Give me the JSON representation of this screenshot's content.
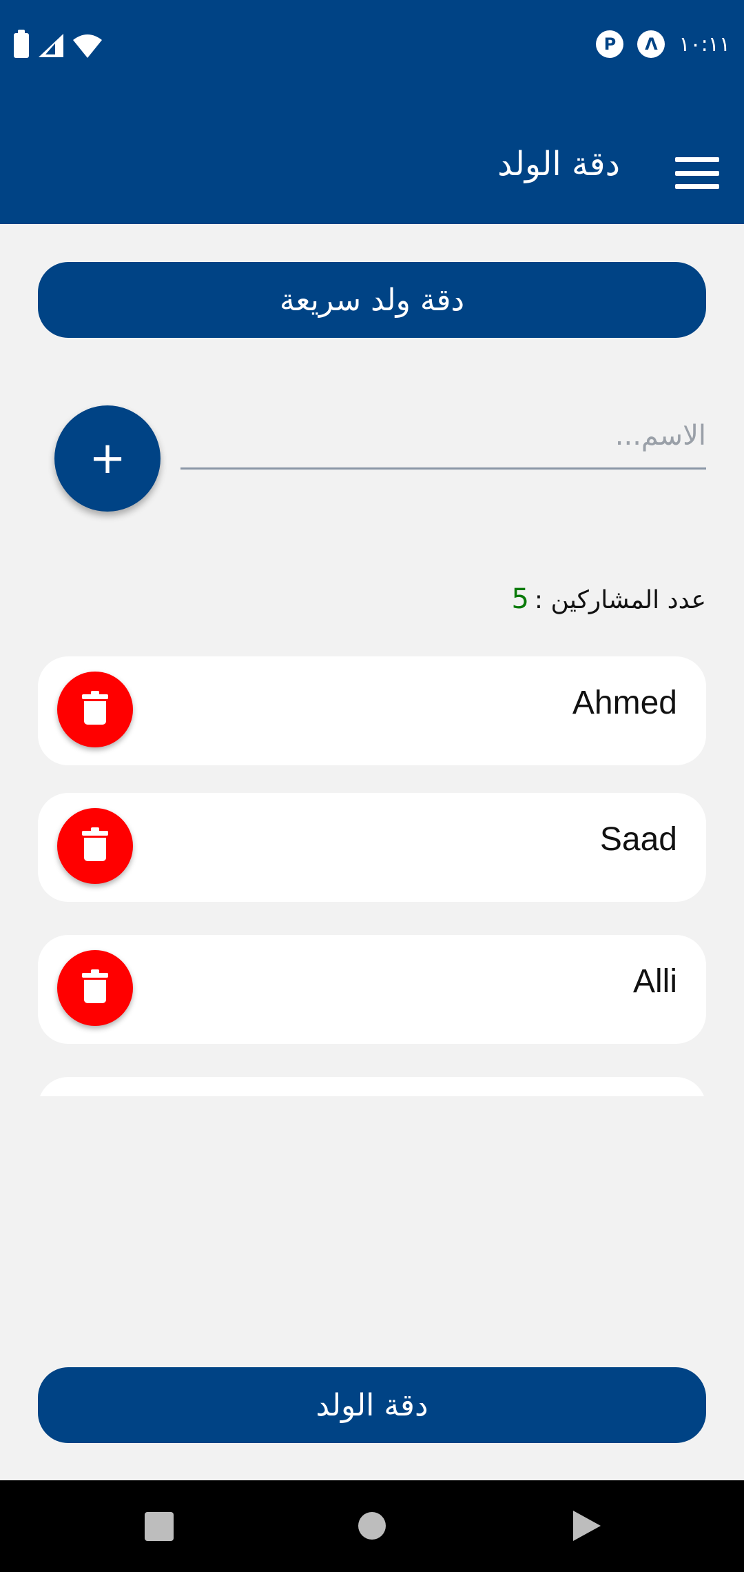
{
  "status_bar": {
    "time": "١٠:١١",
    "icons": [
      "battery-icon",
      "signal-icon",
      "wifi-icon",
      "app-notification-icon",
      "vpn-icon"
    ]
  },
  "app_bar": {
    "title": "دقة الولد",
    "menu_icon": "hamburger-menu-icon"
  },
  "quick_button": {
    "label": "دقة ولد سريعة"
  },
  "name_input": {
    "placeholder": "الاسم...",
    "value": ""
  },
  "add_button": {
    "label": "+"
  },
  "participants": {
    "label": "عدد المشاركين :",
    "count": "5"
  },
  "list": {
    "items": [
      {
        "name": "Ahmed"
      },
      {
        "name": "Saad"
      },
      {
        "name": "Alli"
      },
      {
        "name": ""
      }
    ]
  },
  "main_button": {
    "label": "دقة الولد"
  },
  "colors": {
    "primary": "#004385",
    "delete": "#ff0000",
    "count": "#0a7a0a",
    "background": "#f2f2f2"
  }
}
